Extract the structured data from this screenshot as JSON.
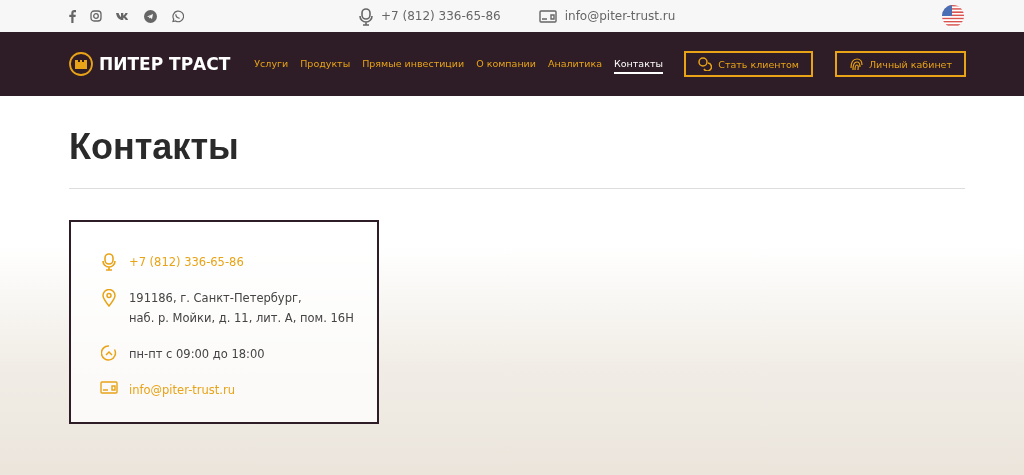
{
  "top_bar": {
    "phone": "+7 (812) 336-65-86",
    "email": "info@piter-trust.ru"
  },
  "header": {
    "logo": "ПИТЕР ТРАСТ",
    "nav": [
      {
        "label": "Услуги",
        "selected": false
      },
      {
        "label": "Продукты",
        "selected": false
      },
      {
        "label": "Прямые инвестиции",
        "selected": false
      },
      {
        "label": "О компании",
        "selected": false
      },
      {
        "label": "Аналитика",
        "selected": false
      },
      {
        "label": "Контакты",
        "selected": true
      }
    ],
    "buttons": [
      {
        "kind": "client",
        "label": "Стать клиентом"
      },
      {
        "kind": "cabinet",
        "label": "Личный кабинет"
      }
    ]
  },
  "page_title": "Контакты",
  "contacts": [
    {
      "kind": "phone",
      "lines": [
        "+7 (812) 336-65-86"
      ]
    },
    {
      "kind": "address",
      "lines": [
        "191186, г. Санкт-Петербург,",
        "наб. р. Мойки, д. 11, лит. А, пом. 16Н"
      ]
    },
    {
      "kind": "hours",
      "lines": [
        "пн-пт с 09:00 до 18:00"
      ]
    },
    {
      "kind": "email",
      "lines": [
        "info@piter-trust.ru"
      ]
    }
  ]
}
